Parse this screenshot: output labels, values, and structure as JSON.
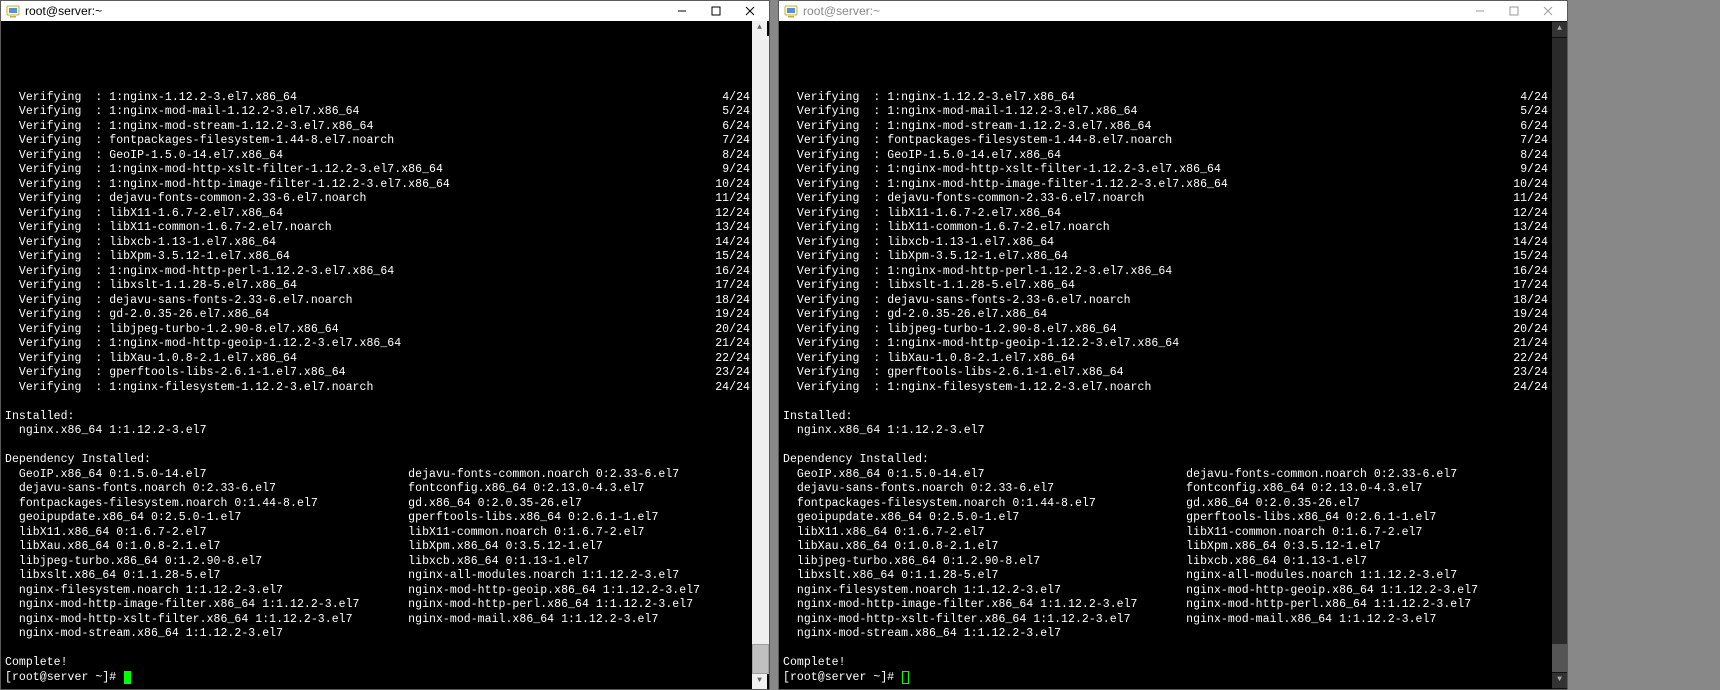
{
  "windows": [
    {
      "title": "root@server:~",
      "active": true,
      "cursor_style": "solid",
      "scrollbar_style": "light"
    },
    {
      "title": "root@server:~",
      "active": false,
      "cursor_style": "hollow",
      "scrollbar_style": "dark"
    }
  ],
  "verifying_label": "Verifying",
  "verifying": [
    {
      "pkg": "1:nginx-1.12.2-3.el7.x86_64",
      "idx": 4,
      "total": 24
    },
    {
      "pkg": "1:nginx-mod-mail-1.12.2-3.el7.x86_64",
      "idx": 5,
      "total": 24
    },
    {
      "pkg": "1:nginx-mod-stream-1.12.2-3.el7.x86_64",
      "idx": 6,
      "total": 24
    },
    {
      "pkg": "fontpackages-filesystem-1.44-8.el7.noarch",
      "idx": 7,
      "total": 24
    },
    {
      "pkg": "GeoIP-1.5.0-14.el7.x86_64",
      "idx": 8,
      "total": 24
    },
    {
      "pkg": "1:nginx-mod-http-xslt-filter-1.12.2-3.el7.x86_64",
      "idx": 9,
      "total": 24
    },
    {
      "pkg": "1:nginx-mod-http-image-filter-1.12.2-3.el7.x86_64",
      "idx": 10,
      "total": 24
    },
    {
      "pkg": "dejavu-fonts-common-2.33-6.el7.noarch",
      "idx": 11,
      "total": 24
    },
    {
      "pkg": "libX11-1.6.7-2.el7.x86_64",
      "idx": 12,
      "total": 24
    },
    {
      "pkg": "libX11-common-1.6.7-2.el7.noarch",
      "idx": 13,
      "total": 24
    },
    {
      "pkg": "libxcb-1.13-1.el7.x86_64",
      "idx": 14,
      "total": 24
    },
    {
      "pkg": "libXpm-3.5.12-1.el7.x86_64",
      "idx": 15,
      "total": 24
    },
    {
      "pkg": "1:nginx-mod-http-perl-1.12.2-3.el7.x86_64",
      "idx": 16,
      "total": 24
    },
    {
      "pkg": "libxslt-1.1.28-5.el7.x86_64",
      "idx": 17,
      "total": 24
    },
    {
      "pkg": "dejavu-sans-fonts-2.33-6.el7.noarch",
      "idx": 18,
      "total": 24
    },
    {
      "pkg": "gd-2.0.35-26.el7.x86_64",
      "idx": 19,
      "total": 24
    },
    {
      "pkg": "libjpeg-turbo-1.2.90-8.el7.x86_64",
      "idx": 20,
      "total": 24
    },
    {
      "pkg": "1:nginx-mod-http-geoip-1.12.2-3.el7.x86_64",
      "idx": 21,
      "total": 24
    },
    {
      "pkg": "libXau-1.0.8-2.1.el7.x86_64",
      "idx": 22,
      "total": 24
    },
    {
      "pkg": "gperftools-libs-2.6.1-1.el7.x86_64",
      "idx": 23,
      "total": 24
    },
    {
      "pkg": "1:nginx-filesystem-1.12.2-3.el7.noarch",
      "idx": 24,
      "total": 24
    }
  ],
  "installed_header": "Installed:",
  "installed": [
    "nginx.x86_64 1:1.12.2-3.el7"
  ],
  "dependency_header": "Dependency Installed:",
  "dependencies": [
    [
      "GeoIP.x86_64 0:1.5.0-14.el7",
      "dejavu-fonts-common.noarch 0:2.33-6.el7"
    ],
    [
      "dejavu-sans-fonts.noarch 0:2.33-6.el7",
      "fontconfig.x86_64 0:2.13.0-4.3.el7"
    ],
    [
      "fontpackages-filesystem.noarch 0:1.44-8.el7",
      "gd.x86_64 0:2.0.35-26.el7"
    ],
    [
      "geoipupdate.x86_64 0:2.5.0-1.el7",
      "gperftools-libs.x86_64 0:2.6.1-1.el7"
    ],
    [
      "libX11.x86_64 0:1.6.7-2.el7",
      "libX11-common.noarch 0:1.6.7-2.el7"
    ],
    [
      "libXau.x86_64 0:1.0.8-2.1.el7",
      "libXpm.x86_64 0:3.5.12-1.el7"
    ],
    [
      "libjpeg-turbo.x86_64 0:1.2.90-8.el7",
      "libxcb.x86_64 0:1.13-1.el7"
    ],
    [
      "libxslt.x86_64 0:1.1.28-5.el7",
      "nginx-all-modules.noarch 1:1.12.2-3.el7"
    ],
    [
      "nginx-filesystem.noarch 1:1.12.2-3.el7",
      "nginx-mod-http-geoip.x86_64 1:1.12.2-3.el7"
    ],
    [
      "nginx-mod-http-image-filter.x86_64 1:1.12.2-3.el7",
      "nginx-mod-http-perl.x86_64 1:1.12.2-3.el7"
    ],
    [
      "nginx-mod-http-xslt-filter.x86_64 1:1.12.2-3.el7",
      "nginx-mod-mail.x86_64 1:1.12.2-3.el7"
    ],
    [
      "nginx-mod-stream.x86_64 1:1.12.2-3.el7",
      ""
    ]
  ],
  "complete": "Complete!",
  "prompt": "[root@server ~]# ",
  "column_widths": {
    "dep_left_pad": 2,
    "dep_col_width": 56
  }
}
